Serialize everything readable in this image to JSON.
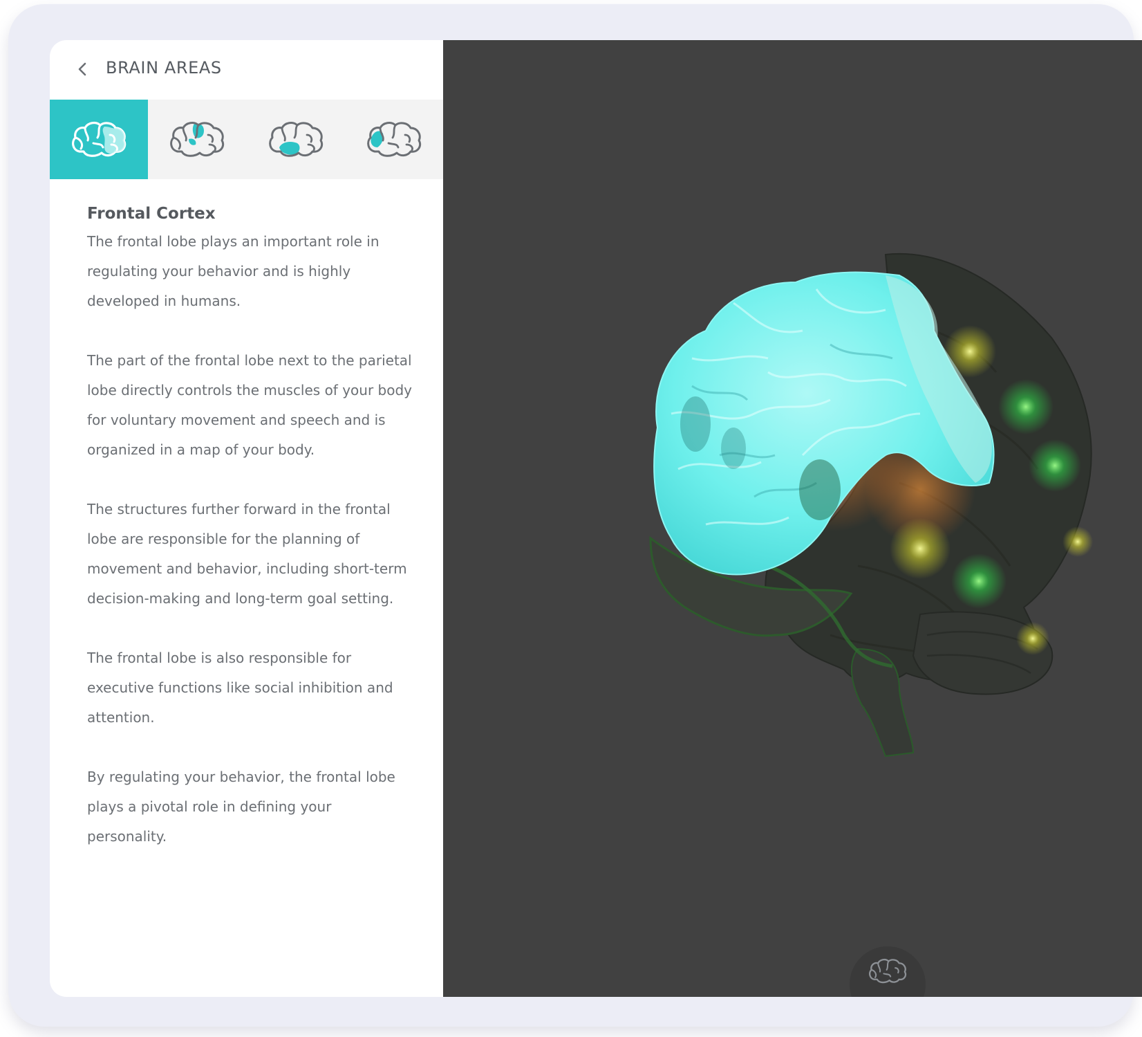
{
  "header": {
    "title": "BRAIN AREAS",
    "back_icon": "chevron-left-icon"
  },
  "tabs": [
    {
      "id": "frontal",
      "icon": "brain-frontal-icon",
      "active": true
    },
    {
      "id": "parietal",
      "icon": "brain-parietal-icon",
      "active": false
    },
    {
      "id": "temporal",
      "icon": "brain-temporal-icon",
      "active": false
    },
    {
      "id": "occipital",
      "icon": "brain-occipital-icon",
      "active": false
    }
  ],
  "content": {
    "title": "Frontal Cortex",
    "paragraphs": [
      "The frontal lobe plays an important role in regulating your behavior and is highly developed in humans.",
      "The part of the frontal lobe next to the parietal lobe directly controls the muscles of your body for voluntary movement and speech and is organized in a map of your body.",
      "The structures further forward in the frontal lobe are responsible for the planning of movement and behavior, including short-term decision-making and long-term goal setting.",
      "The frontal lobe is also responsible for executive functions like social inhibition and attention.",
      "By regulating your behavior, the frontal lobe plays a pivotal role in defining your personality."
    ]
  },
  "viewer": {
    "toggle_icon": "brain-icon"
  },
  "colors": {
    "accent": "#2dc4c6",
    "panel_bg": "#ffffff",
    "tabs_bg": "#f3f3f3",
    "viewer_bg": "#414141",
    "frontal_highlight": "#6ff3f0",
    "activity_green": "#3cff5a",
    "activity_yellow": "#e8e83a"
  }
}
